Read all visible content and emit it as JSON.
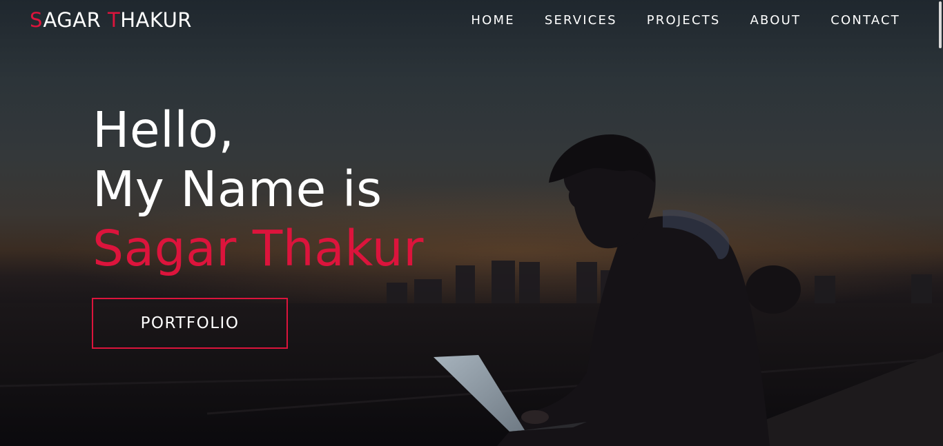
{
  "brand": {
    "first_initial": "S",
    "first_rest": "AGAR ",
    "last_initial": "T",
    "last_rest": "HAKUR"
  },
  "nav": {
    "items": [
      {
        "label": "HOME"
      },
      {
        "label": "SERVICES"
      },
      {
        "label": "PROJECTS"
      },
      {
        "label": "ABOUT"
      },
      {
        "label": "CONTACT"
      }
    ]
  },
  "hero": {
    "line1": "Hello,",
    "line2": "My Name is",
    "name": "Sagar Thakur",
    "button_label": "PORTFOLIO"
  },
  "colors": {
    "accent": "#dc143c",
    "text": "#ffffff",
    "background": "#0e0d10"
  }
}
